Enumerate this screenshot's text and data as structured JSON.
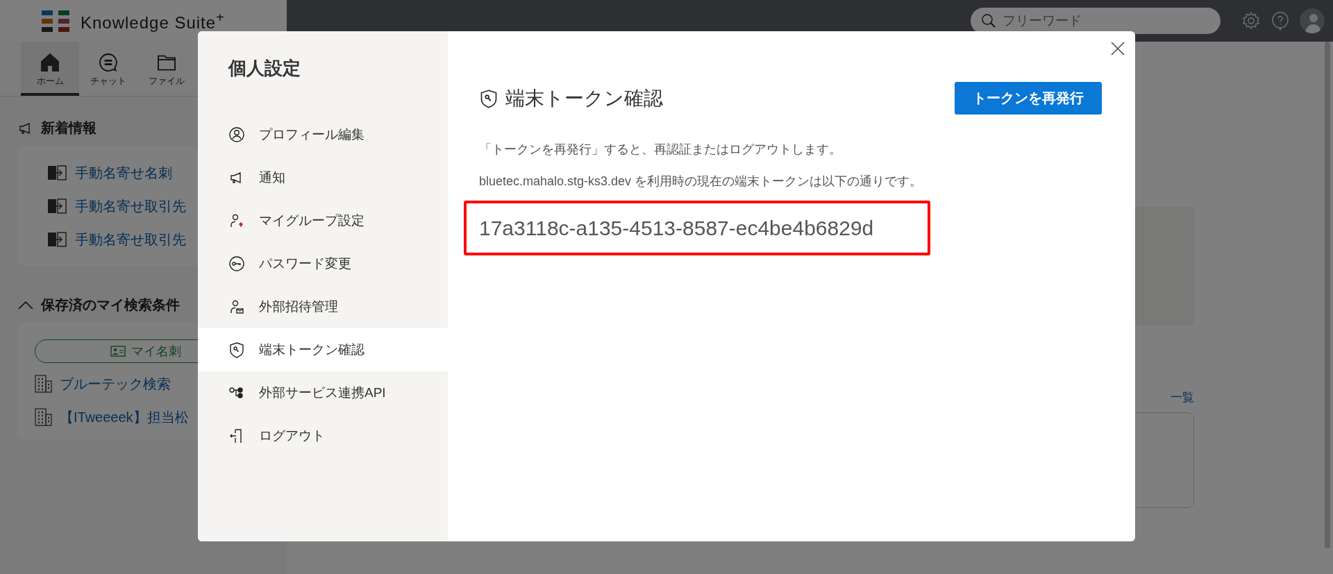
{
  "header": {
    "logo": "Knowledge Suite$^{+}$",
    "search": {
      "placeholder": "フリーワード"
    }
  },
  "nav_tabs": [
    {
      "label": "ホーム",
      "kind": "home",
      "selected": true
    },
    {
      "label": "チャット",
      "kind": "chat",
      "selected": false
    },
    {
      "label": "ファイル",
      "kind": "folder",
      "selected": false
    }
  ],
  "news": {
    "title": "新着情報",
    "items": [
      "手動名寄せ名刺",
      "手動名寄せ取引先",
      "手動名寄せ取引先"
    ]
  },
  "saved_searches": {
    "title": "保存済のマイ検索条件",
    "expanded": true,
    "filter_button": "マイ名刺",
    "items": [
      "ブルーテック検索",
      "【ITweeeek】担当松"
    ]
  },
  "main": {
    "list_link": "一覧"
  },
  "modal": {
    "title": "個人設定",
    "menu": [
      {
        "label": "プロフィール編集",
        "kind": "profile",
        "selected": false
      },
      {
        "label": "通知",
        "kind": "megaphone",
        "selected": false
      },
      {
        "label": "マイグループ設定",
        "kind": "group",
        "selected": false
      },
      {
        "label": "パスワード変更",
        "kind": "key",
        "selected": false
      },
      {
        "label": "外部招待管理",
        "kind": "invite",
        "selected": false
      },
      {
        "label": "端末トークン確認",
        "kind": "shield",
        "selected": true
      },
      {
        "label": "外部サービス連携API",
        "kind": "api",
        "selected": false
      },
      {
        "label": "ログアウト",
        "kind": "logout",
        "selected": false
      }
    ],
    "heading": "端末トークン確認",
    "reissue_button": "トークンを再発行",
    "notice": "「トークンを再発行」すると、再認証またはログアウトします。",
    "description": "bluetec.mahalo.stg-ks3.dev を利用時の現在の端末トークンは以下の通りです。",
    "token": "17a3118c-a135-4513-8587-ec4be4b6829d"
  }
}
